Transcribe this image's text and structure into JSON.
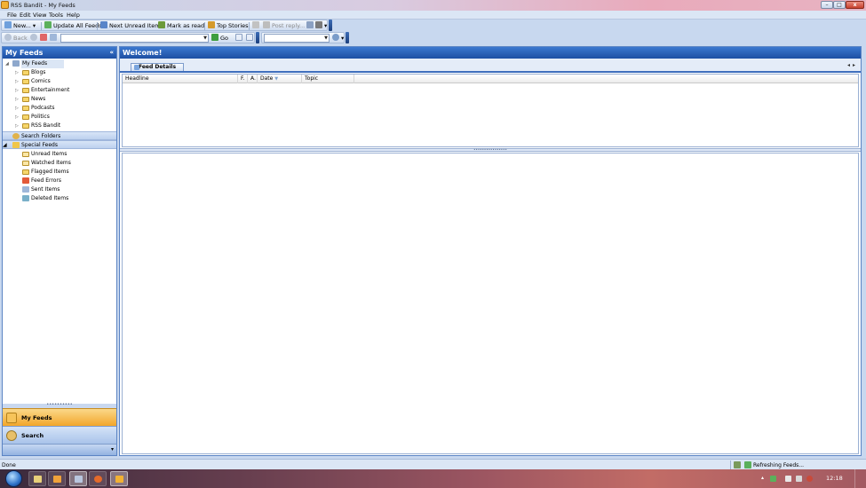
{
  "window": {
    "title": "RSS Bandit - My Feeds",
    "controls": {
      "minimize": "–",
      "maximize": "□",
      "close": "x"
    }
  },
  "menu": [
    "File",
    "Edit",
    "View",
    "Tools",
    "Help"
  ],
  "toolbar1": {
    "new_label": "New...",
    "update_all": "Update All Feeds",
    "next_unread": "Next Unread Item",
    "mark_read": "Mark as read",
    "top_stories": "Top Stories",
    "post_reply": "Post reply..."
  },
  "toolbar2": {
    "back_label": "Back",
    "go_label": "Go",
    "address_value": "",
    "search_value": ""
  },
  "left_panel": {
    "title": "My Feeds",
    "tree": {
      "root": "My Feeds",
      "folders": [
        "Blogs",
        "Comics",
        "Entertainment",
        "News",
        "Podcasts",
        "Politics",
        "RSS Bandit"
      ],
      "search_folders": "Search Folders",
      "special_feeds": "Special Feeds",
      "special_items": [
        "Unread Items",
        "Watched Items",
        "Flagged Items",
        "Feed Errors",
        "Sent Items",
        "Deleted Items"
      ]
    },
    "nav": {
      "my_feeds": "My Feeds",
      "search": "Search"
    }
  },
  "right_panel": {
    "title": "Welcome!",
    "tab": "Feed Details",
    "columns": [
      "Headline",
      "F.",
      "A.",
      "Date",
      "Topic"
    ]
  },
  "status": {
    "left": "Done",
    "right": "Refreshing Feeds..."
  },
  "taskbar": {
    "clock": "12:18"
  },
  "colors": {
    "header_blue": "#1d4fa3",
    "nav_active": "#f2a62a",
    "folder_yellow": "#f6d66b"
  }
}
